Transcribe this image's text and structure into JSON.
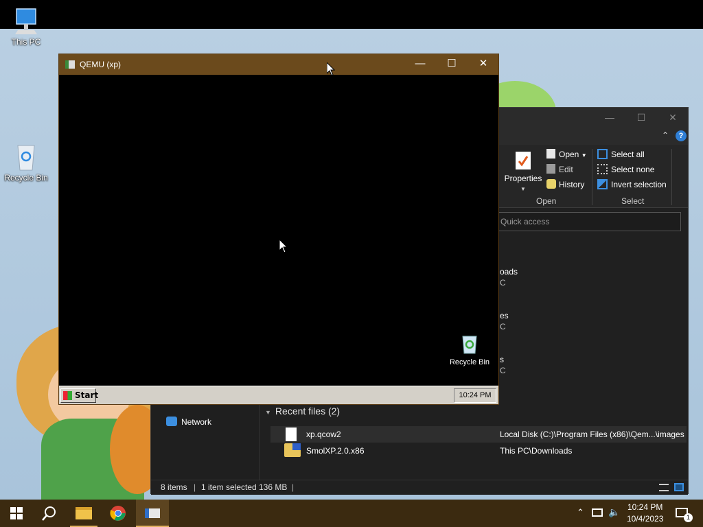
{
  "desktop": {
    "icons": [
      {
        "label": "This PC"
      },
      {
        "label": "Recycle Bin"
      }
    ]
  },
  "explorer": {
    "ribbon": {
      "properties_label": "Properties",
      "open_label": "Open",
      "edit_label": "Edit",
      "history_label": "History",
      "open_group": "Open",
      "select_all": "Select all",
      "select_none": "Select none",
      "invert_selection": "Invert selection",
      "select_group": "Select"
    },
    "address_placeholder": "Quick access",
    "nav": {
      "network_label": "Network"
    },
    "partial_labels": [
      "oads",
      "C",
      "es",
      "C",
      "s",
      "C"
    ],
    "recent_header": "Recent files (2)",
    "files": [
      {
        "name": "xp.qcow2",
        "path": "Local Disk (C:)\\Program Files (x86)\\Qem...\\images"
      },
      {
        "name": "SmolXP.2.0.x86",
        "path": "This PC\\Downloads"
      }
    ],
    "status": {
      "items": "8 items",
      "selected": "1 item selected",
      "size": "136 MB"
    }
  },
  "qemu": {
    "title": "QEMU (xp)",
    "recycle_label": "Recycle Bin",
    "start_label": "Start",
    "clock": "10:24 PM"
  },
  "taskbar": {
    "time": "10:24 PM",
    "date": "10/4/2023",
    "notification_count": "1"
  },
  "colors": {
    "accent": "#6b4a1c",
    "taskbar": "#3b2a10",
    "explorer_bg": "#202020"
  }
}
